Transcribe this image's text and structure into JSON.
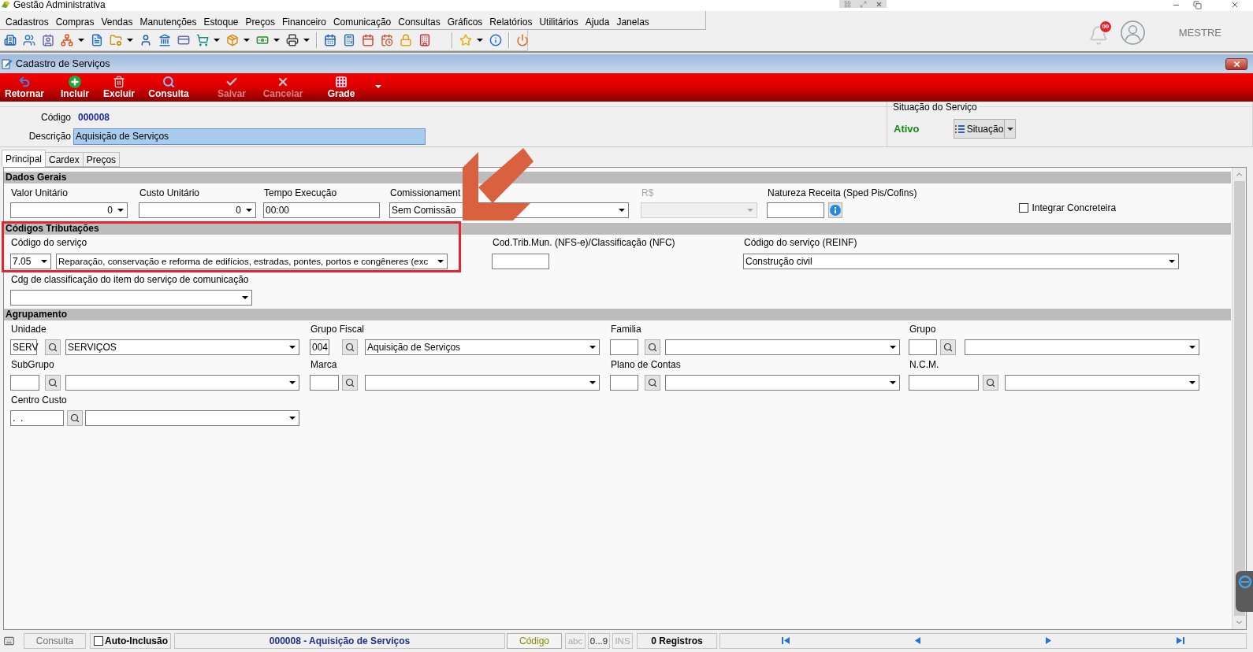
{
  "app": {
    "title": "Gestão Administrativa",
    "menu": [
      "Cadastros",
      "Compras",
      "Vendas",
      "Manutenções",
      "Estoque",
      "Preços",
      "Financeiro",
      "Comunicação",
      "Consultas",
      "Gráficos",
      "Relatórios",
      "Utilitários",
      "Ajuda",
      "Janelas"
    ],
    "notifications": "00",
    "user": "MESTRE"
  },
  "window": {
    "title": "Cadastro de Serviços"
  },
  "actions": [
    {
      "label": "Retornar",
      "disabled": false
    },
    {
      "label": "Incluir",
      "disabled": false
    },
    {
      "label": "Excluir",
      "disabled": false
    },
    {
      "label": "Consulta",
      "disabled": false
    },
    {
      "label": "Salvar",
      "disabled": true
    },
    {
      "label": "Cancelar",
      "disabled": true
    },
    {
      "label": "Grade",
      "disabled": false
    }
  ],
  "header": {
    "codigo": {
      "label": "Código",
      "value": "000008"
    },
    "descricao": {
      "label": "Descrição",
      "value": "Aquisição de Serviços"
    },
    "situacao": {
      "title": "Situação do Serviço",
      "status": "Ativo",
      "button": "Situação"
    }
  },
  "tabs": [
    {
      "label": "Principal",
      "selected": true
    },
    {
      "label": "Cardex",
      "selected": false
    },
    {
      "label": "Preços",
      "selected": false
    }
  ],
  "dados_gerais": {
    "title": "Dados Gerais",
    "valor_unitario": {
      "label": "Valor Unitário",
      "value": "0"
    },
    "custo_unitario": {
      "label": "Custo Unitário",
      "value": "0"
    },
    "tempo_execucao": {
      "label": "Tempo Execução",
      "value": "00:00"
    },
    "comissionamento": {
      "label": "Comissionament",
      "value": "Sem Comissão"
    },
    "rs": {
      "label": "R$",
      "disabled": true
    },
    "natureza_receita": {
      "label": "Natureza Receita (Sped Pis/Cofins)"
    },
    "integrar_concreteira": {
      "label": "Integrar Concreteira",
      "checked": false
    }
  },
  "codigos_tributacoes": {
    "title": "Códigos Tributações",
    "codigo_servico": {
      "label": "Código do serviço",
      "code": "7.05",
      "description": "Reparação, conservação e reforma de edifícios, estradas, pontes, portos e congêneres (exc"
    },
    "cod_trib_mun": {
      "label": "Cod.Trib.Mun. (NFS-e)/Classificação (NFC)"
    },
    "codigo_servico_reinf": {
      "label": "Código do serviço (REINF)",
      "value": "Construção civil"
    },
    "classificacao_comunicacao": {
      "label": "Cdg de classificação do item do serviço de comunicação"
    }
  },
  "agrupamento": {
    "title": "Agrupamento",
    "fields": [
      {
        "label": "Unidade",
        "code": "SERV",
        "description": "SERVIÇOS"
      },
      {
        "label": "Grupo Fiscal",
        "code": "004",
        "description": "Aquisição de Serviços"
      },
      {
        "label": "Familia"
      },
      {
        "label": "Grupo"
      },
      {
        "label": "SubGrupo"
      },
      {
        "label": "Marca"
      },
      {
        "label": "Plano de Contas"
      },
      {
        "label": "N.C.M."
      },
      {
        "label": "Centro Custo",
        "code": ".  ."
      }
    ]
  },
  "annotations": {
    "frame": true,
    "arrow": true
  },
  "status_bar": {
    "mode": "Consulta",
    "auto_inclusao": {
      "label": "Auto-Inclusão",
      "checked": false
    },
    "record": "000008 - Aquisição de Serviços",
    "order": "Código",
    "indicators": [
      {
        "label": "abc",
        "on": false
      },
      {
        "label": "0...9",
        "on": true
      },
      {
        "label": "INS",
        "on": false
      }
    ],
    "count": "0 Registros"
  }
}
